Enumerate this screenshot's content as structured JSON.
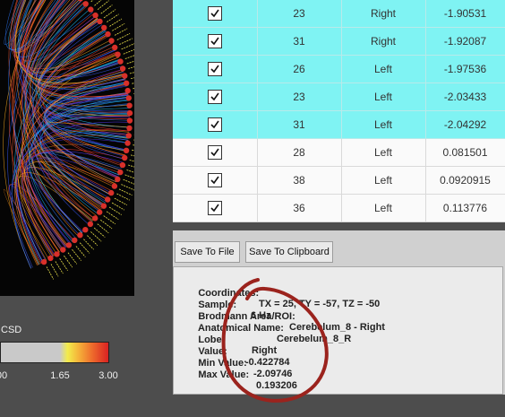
{
  "colorbar": {
    "label": "CSD",
    "ticks": [
      "00",
      "1.65",
      "3.00"
    ],
    "colors": [
      "#c9c9c9",
      "#f2ec4b",
      "#ee6b2c",
      "#d92222"
    ]
  },
  "table": {
    "selected_color": "#7ff3f3",
    "rows": [
      {
        "checked": true,
        "selected": true,
        "num": "23",
        "side": "Right",
        "value": "-1.90531"
      },
      {
        "checked": true,
        "selected": true,
        "num": "31",
        "side": "Right",
        "value": "-1.92087"
      },
      {
        "checked": true,
        "selected": true,
        "num": "26",
        "side": "Left",
        "value": "-1.97536"
      },
      {
        "checked": true,
        "selected": true,
        "num": "23",
        "side": "Left",
        "value": "-2.03433"
      },
      {
        "checked": true,
        "selected": true,
        "num": "31",
        "side": "Left",
        "value": "-2.04292"
      },
      {
        "checked": true,
        "selected": false,
        "num": "28",
        "side": "Left",
        "value": "0.081501"
      },
      {
        "checked": true,
        "selected": false,
        "num": "38",
        "side": "Left",
        "value": "0.0920915"
      },
      {
        "checked": true,
        "selected": false,
        "num": "36",
        "side": "Left",
        "value": "0.113776"
      }
    ]
  },
  "buttons": {
    "save_file": "Save To File",
    "save_clipboard": "Save To Clipboard"
  },
  "info": {
    "coordinates_label": "Coordinates:",
    "coordinates_value": "TX = 25, TY = -57, TZ = -50",
    "sample_label": "Sample:",
    "sample_value": "6 Hz",
    "brodmann_label": "Brodmann Area/ROI:",
    "brodmann_value": "Cerebelum_8 - Right",
    "anatomical_label": "Anatomical Name:",
    "anatomical_value": "Cerebelum_8_R",
    "lobe_label": "Lobe:",
    "lobe_value": "Right",
    "value_label": "Value:",
    "value_value": "-0.422784",
    "min_label": "Min Value:",
    "min_value": "-2.09746",
    "max_label": "Max Value:",
    "max_value": "0.193206"
  },
  "annotation": {
    "circle_color": "#9b231d"
  }
}
